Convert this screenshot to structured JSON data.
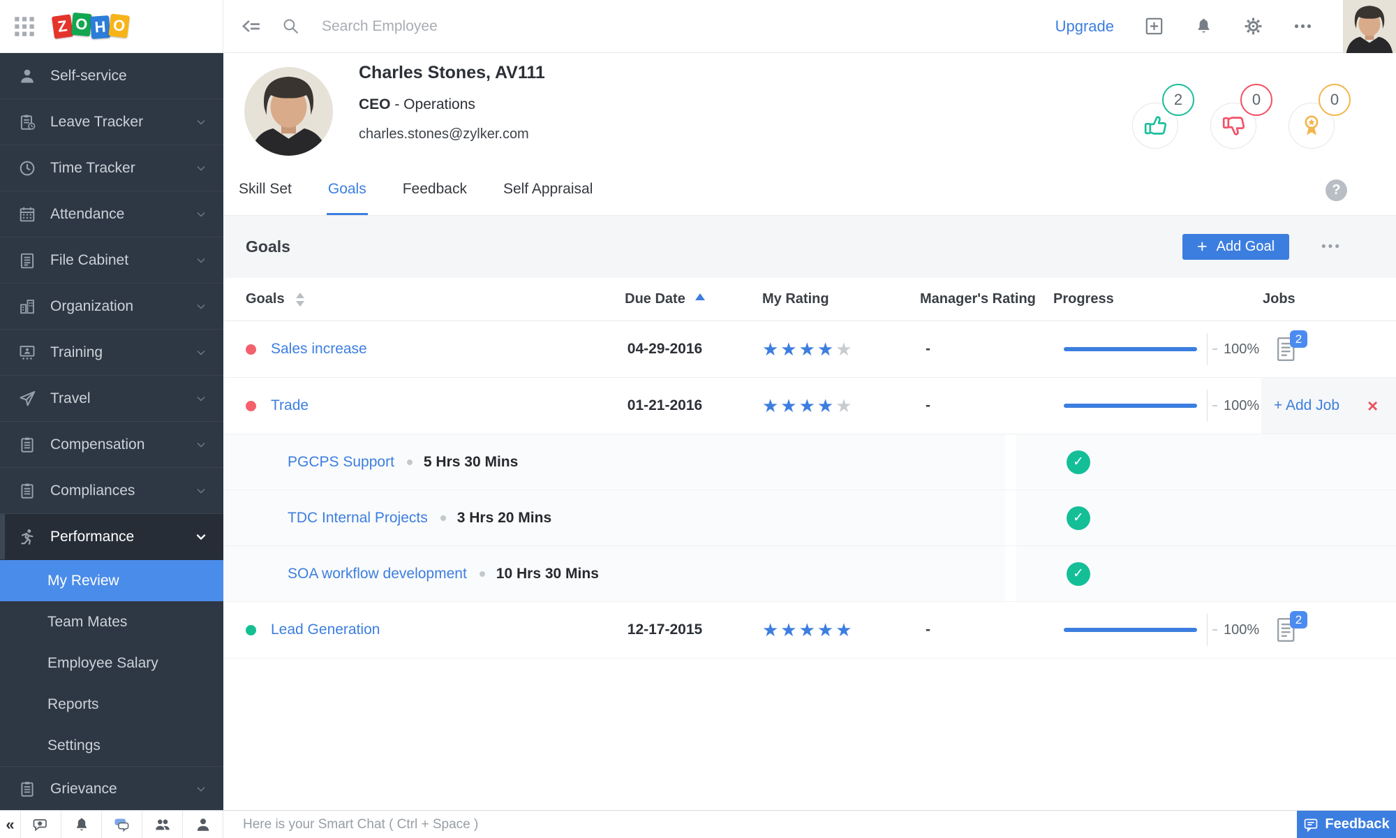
{
  "topbar": {
    "logo_letters": [
      "Z",
      "O",
      "H",
      "O"
    ],
    "search_placeholder": "Search Employee",
    "upgrade_label": "Upgrade"
  },
  "sidebar": {
    "items": [
      {
        "label": "Self-service",
        "icon": "user"
      },
      {
        "label": "Leave Tracker",
        "icon": "clipboard-clock",
        "chevron": "down"
      },
      {
        "label": "Time Tracker",
        "icon": "clock",
        "chevron": "down"
      },
      {
        "label": "Attendance",
        "icon": "calendar",
        "chevron": "down"
      },
      {
        "label": "File Cabinet",
        "icon": "notepad",
        "chevron": "down"
      },
      {
        "label": "Organization",
        "icon": "building",
        "chevron": "down"
      },
      {
        "label": "Training",
        "icon": "screen",
        "chevron": "down"
      },
      {
        "label": "Travel",
        "icon": "plane",
        "chevron": "down"
      },
      {
        "label": "Compensation",
        "icon": "clipboard",
        "chevron": "down"
      },
      {
        "label": "Compliances",
        "icon": "clipboard",
        "chevron": "down"
      },
      {
        "label": "Performance",
        "icon": "runner",
        "chevron": "down",
        "state": "expanded-active"
      },
      {
        "label": "My Review",
        "sub": true,
        "state": "selected"
      },
      {
        "label": "Team Mates",
        "sub": true
      },
      {
        "label": "Employee Salary",
        "sub": true
      },
      {
        "label": "Reports",
        "sub": true
      },
      {
        "label": "Settings",
        "sub": true
      },
      {
        "label": "Grievance",
        "icon": "clipboard",
        "chevron": "down"
      }
    ]
  },
  "profile": {
    "name": "Charles Stones, AV111",
    "designation": "CEO",
    "designation_suffix": " - Operations",
    "email": "charles.stones@zylker.com",
    "badges": [
      {
        "icon": "thumb-up-icon",
        "count": "2",
        "color": "#1dbf9a"
      },
      {
        "icon": "thumb-down-icon",
        "count": "0",
        "color": "#f25268"
      },
      {
        "icon": "award-icon",
        "count": "0",
        "color": "#f3b64f"
      }
    ]
  },
  "tabs": [
    {
      "label": "Skill Set",
      "active": false
    },
    {
      "label": "Goals",
      "active": true
    },
    {
      "label": "Feedback",
      "active": false
    },
    {
      "label": "Self Appraisal",
      "active": false
    }
  ],
  "help_glyph": "?",
  "goals_section": {
    "title": "Goals",
    "add_button_plus": "+",
    "add_button_label": "Add Goal",
    "menu_dots": "•••"
  },
  "table": {
    "columns": [
      "Goals",
      "Due Date",
      "My Rating",
      "Manager's Rating",
      "Progress",
      "Jobs"
    ],
    "rows": [
      {
        "name": "Sales increase",
        "status_color": "#f4606c",
        "due_date": "04-29-2016",
        "stars_filled": "★★★★",
        "stars_empty": "★",
        "manager_rating": "-",
        "progress_pct": "100%",
        "jobs_count": "2"
      },
      {
        "name": "Trade",
        "status_color": "#f4606c",
        "due_date": "01-21-2016",
        "stars_filled": "★★★★",
        "stars_empty": "★",
        "manager_rating": "-",
        "progress_pct": "100%",
        "add_job_label": "+ Add Job",
        "remove_glyph": "×"
      },
      {
        "name": "Lead Generation",
        "status_color": "#16bf92",
        "due_date": "12-17-2015",
        "stars_filled": "★★★★★",
        "stars_empty": "",
        "manager_rating": "-",
        "progress_pct": "100%",
        "jobs_count": "2"
      }
    ],
    "subrows": [
      {
        "name": "PGCPS Support",
        "time": "5 Hrs 30 Mins"
      },
      {
        "name": "TDC Internal Projects",
        "time": "3 Hrs 20 Mins"
      },
      {
        "name": "SOA workflow development",
        "time": "10 Hrs 30 Mins"
      }
    ],
    "check_glyph": "✓"
  },
  "bottombar": {
    "collapse_glyph": "«",
    "chat_placeholder": "Here is your Smart Chat ( Ctrl + Space )",
    "feedback_label": "Feedback"
  },
  "colors": {
    "accent_blue": "#3c7ee0",
    "sidebar_bg": "#2e3744",
    "selected_blue": "#4a8cea",
    "link_blue": "#3c7ee0",
    "red_status": "#f4606c",
    "green_status": "#16bf92",
    "check_green": "#14bf98",
    "star_blue": "#3c7ee0",
    "star_gray": "#c7ccd1",
    "jobs_badge_blue": "#4b8bf0",
    "thumb_up": "#1dbf9a",
    "thumb_down": "#f25268",
    "award_yellow": "#f3b64f"
  }
}
